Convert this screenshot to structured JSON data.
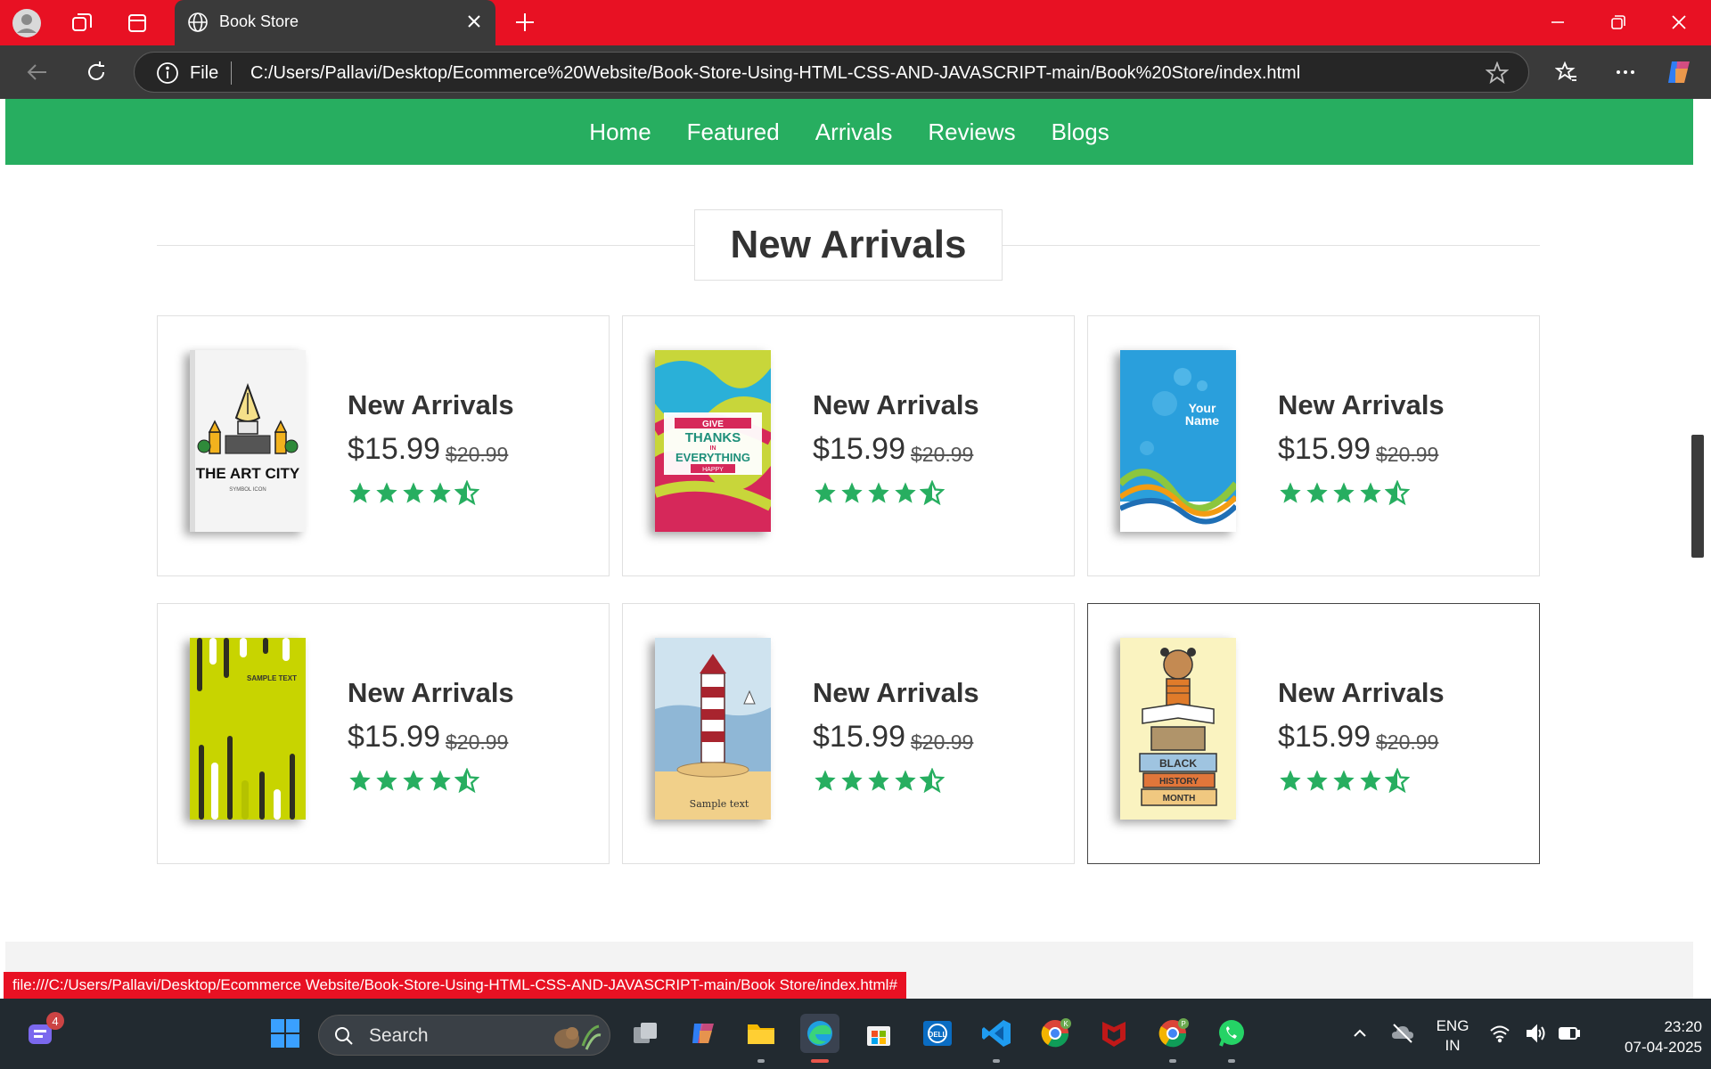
{
  "browser": {
    "tab_title": "Book Store",
    "omnibox_label": "File",
    "url": "C:/Users/Pallavi/Desktop/Ecommerce%20Website/Book-Store-Using-HTML-CSS-AND-JAVASCRIPT-main/Book%20Store/index.html",
    "status_url": "file:///C:/Users/Pallavi/Desktop/Ecommerce Website/Book-Store-Using-HTML-CSS-AND-JAVASCRIPT-main/Book Store/index.html#",
    "accent_color": "#e81123"
  },
  "nav": {
    "links": [
      "Home",
      "Featured",
      "Arrivals",
      "Reviews",
      "Blogs"
    ],
    "color": "#27ae60"
  },
  "section": {
    "heading": "New Arrivals"
  },
  "products": [
    {
      "title": "New Arrivals",
      "price": "$15.99",
      "old_price": "$20.99",
      "rating": 4.5,
      "cover": "art-city"
    },
    {
      "title": "New Arrivals",
      "price": "$15.99",
      "old_price": "$20.99",
      "rating": 4.5,
      "cover": "thanks"
    },
    {
      "title": "New Arrivals",
      "price": "$15.99",
      "old_price": "$20.99",
      "rating": 4.5,
      "cover": "your-name"
    },
    {
      "title": "New Arrivals",
      "price": "$15.99",
      "old_price": "$20.99",
      "rating": 4.5,
      "cover": "sample-text"
    },
    {
      "title": "New Arrivals",
      "price": "$15.99",
      "old_price": "$20.99",
      "rating": 4.5,
      "cover": "lighthouse"
    },
    {
      "title": "New Arrivals",
      "price": "$15.99",
      "old_price": "$20.99",
      "rating": 4.5,
      "cover": "black-history"
    }
  ],
  "covers": {
    "art_city_title": "THE ART CITY",
    "art_city_sub": "SYMBOL ICON",
    "thanks_1": "GIVE",
    "thanks_2": "THANKS",
    "thanks_3": "IN",
    "thanks_4": "EVERYTHING",
    "thanks_5": "HAPPY",
    "your_name_1": "Your",
    "your_name_2": "Name",
    "sample_text": "SAMPLE TEXT",
    "lighthouse_text": "Sample text",
    "bh_1": "BLACK",
    "bh_2": "HISTORY",
    "bh_3": "MONTH"
  },
  "taskbar": {
    "search_placeholder": "Search",
    "lang_1": "ENG",
    "lang_2": "IN",
    "time": "23:20",
    "date": "07-04-2025",
    "notification_count": "4",
    "chrome_badge_k": "K",
    "chrome_badge_p": "P"
  }
}
